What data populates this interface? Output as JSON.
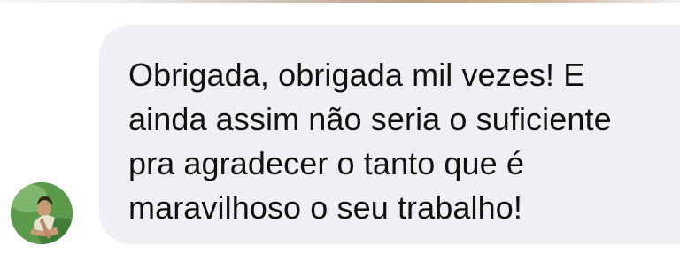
{
  "conversation": {
    "message": {
      "text": "Obrigada, obrigada mil vezes! E\nainda assim não seria o suficiente\npra agradecer o tanto que é\nmaravilhoso o seu trabalho!"
    },
    "sender": {
      "avatar_icon": "profile-photo"
    }
  },
  "colors": {
    "bubble_background": "#eff0f3",
    "text": "#111111",
    "page_background": "#ffffff"
  }
}
